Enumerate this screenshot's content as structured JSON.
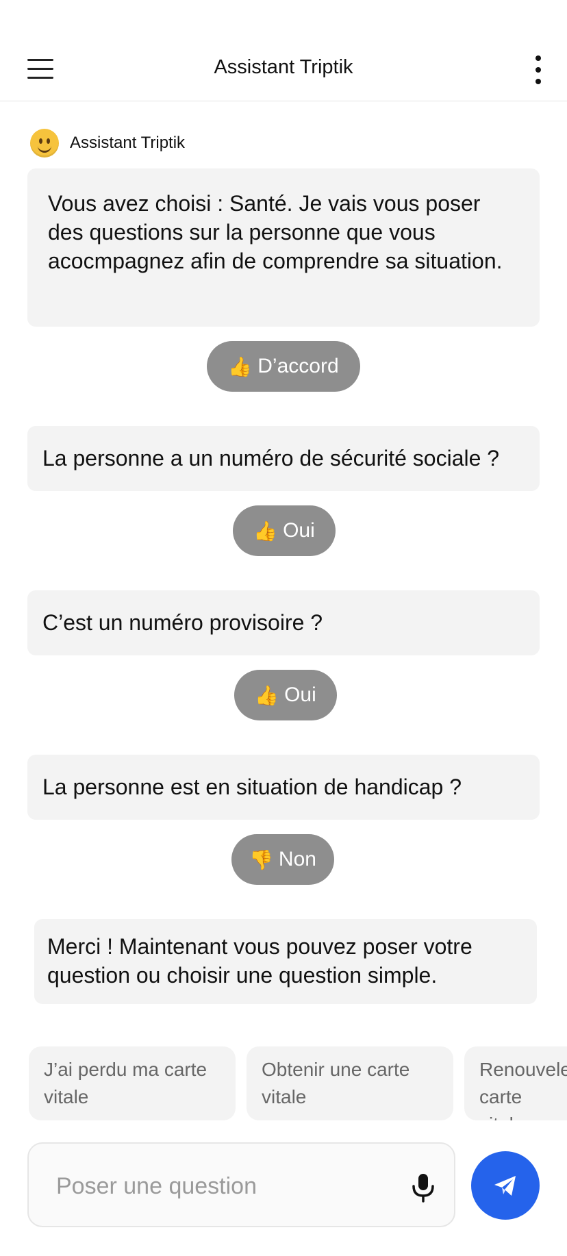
{
  "header": {
    "title": "Assistant Triptik"
  },
  "bot": {
    "name": "Assistant Triptik"
  },
  "messages": [
    {
      "text": "Vous avez choisi : Santé. Je vais vous poser des questions sur la personne que vous acocmpagnez afin de comprendre sa situation.",
      "reply_emoji": "👍",
      "reply": "D’accord"
    },
    {
      "text": "La personne a un numéro de sécurité sociale ?",
      "reply_emoji": "👍",
      "reply": "Oui"
    },
    {
      "text": "C’est un numéro provisoire ?",
      "reply_emoji": "👍",
      "reply": "Oui"
    },
    {
      "text": "La personne est en situation de handicap ?",
      "reply_emoji": "👎",
      "reply": "Non"
    },
    {
      "text": "Merci ! Maintenant vous pouvez poser votre question ou choisir une question simple."
    }
  ],
  "suggestions": [
    "J’ai perdu ma carte vitale",
    "Obtenir une carte vitale",
    "Renouveler carte vitale"
  ],
  "composer": {
    "placeholder": "Poser une question",
    "value": ""
  },
  "colors": {
    "accent": "#2563eb",
    "bubble": "#f3f3f3",
    "reply": "#8e8e8e"
  },
  "icons": {
    "menu": "menu-icon",
    "more": "more-vertical-icon",
    "avatar": "smiley-emoji",
    "mic": "microphone-icon",
    "send": "send-plane-icon"
  }
}
